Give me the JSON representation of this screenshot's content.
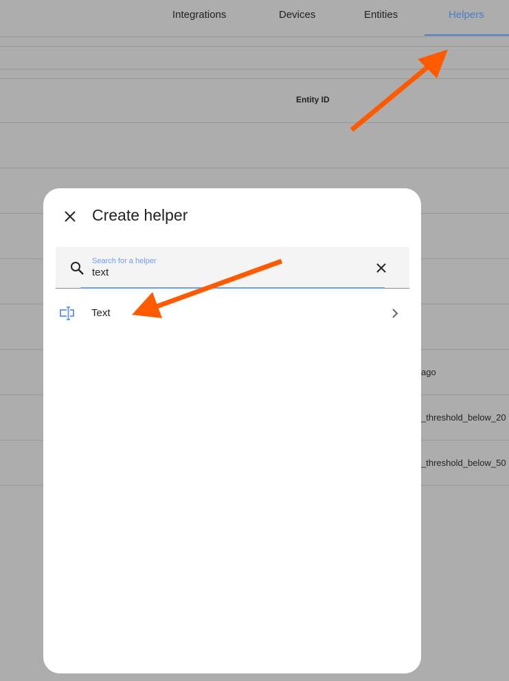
{
  "tabs": [
    {
      "label": "Integrations"
    },
    {
      "label": "Devices"
    },
    {
      "label": "Entities"
    },
    {
      "label": "Helpers",
      "active": true
    }
  ],
  "background": {
    "column_header": "Entity ID",
    "rows": [
      "ago",
      "_threshold_below_20",
      "_threshold_below_50"
    ]
  },
  "dialog": {
    "title": "Create helper",
    "search": {
      "label": "Search for a helper",
      "value": "text"
    },
    "results": [
      {
        "label": "Text",
        "icon": "form-textbox-icon"
      }
    ]
  },
  "colors": {
    "accent": "#4a7cc4",
    "annotation_arrow": "#ff5a00",
    "icon_blue": "#6b9ee8"
  }
}
